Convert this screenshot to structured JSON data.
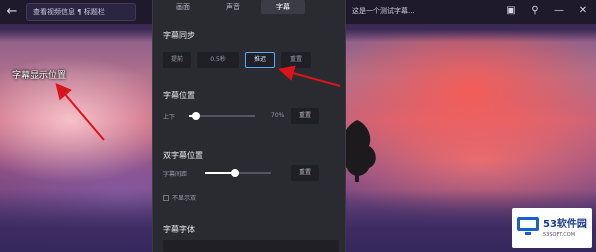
{
  "topbar": {
    "title_text": "查看视频信息 ¶ 标题栏",
    "right_title": "这是一个测试字幕..."
  },
  "video": {
    "subtitle_preview": "字幕显示位置"
  },
  "panel": {
    "tabs": [
      {
        "label": "画面",
        "active": false
      },
      {
        "label": "声音",
        "active": false
      },
      {
        "label": "字幕",
        "active": true
      }
    ],
    "sync": {
      "title": "字幕同步",
      "buttons": [
        {
          "label": "提前",
          "selected": false
        },
        {
          "label": "0.5秒",
          "selected": false
        },
        {
          "label": "推迟",
          "selected": true
        },
        {
          "label": "重置",
          "selected": false
        }
      ]
    },
    "position": {
      "title": "字幕位置",
      "left_label": "上下",
      "value_label": "70%",
      "reset_label": "重置",
      "level": 0.1
    },
    "dual_position": {
      "title": "双字幕位置",
      "left_label": "字幕间距",
      "reset_label": "重置",
      "level": 0.45,
      "checkbox_label": "不显示双"
    },
    "font": {
      "title": "字幕字体"
    }
  },
  "logo": {
    "brand": "53软件园",
    "url": "53SOFT.COM"
  },
  "colors": {
    "panel_bg": "#2a2a31",
    "accent": "#5aa7ff",
    "arrow": "#d8141c"
  }
}
